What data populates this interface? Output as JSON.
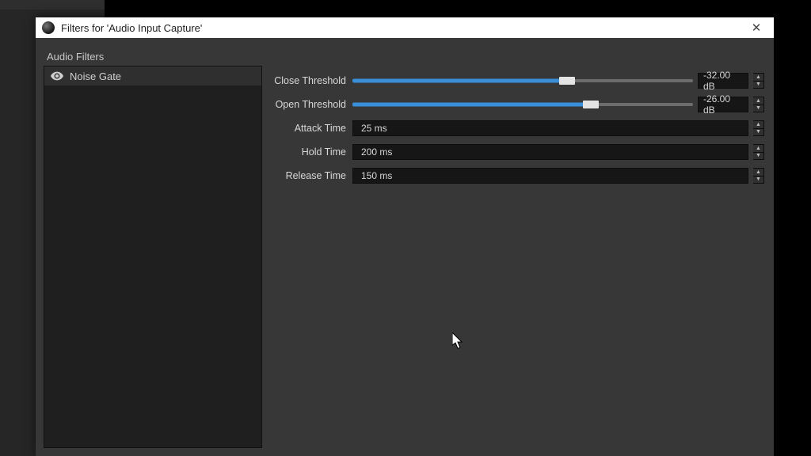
{
  "titlebar": {
    "title": "Filters for 'Audio Input Capture'"
  },
  "section_label": "Audio Filters",
  "filters": [
    {
      "name": "Noise Gate",
      "visible": true
    }
  ],
  "properties": {
    "close_threshold": {
      "label": "Close Threshold",
      "value": "-32.00 dB",
      "fill_pct": 63
    },
    "open_threshold": {
      "label": "Open Threshold",
      "value": "-26.00 dB",
      "fill_pct": 70
    },
    "attack_time": {
      "label": "Attack Time",
      "value": "25 ms"
    },
    "hold_time": {
      "label": "Hold Time",
      "value": "200 ms"
    },
    "release_time": {
      "label": "Release Time",
      "value": "150 ms"
    }
  }
}
